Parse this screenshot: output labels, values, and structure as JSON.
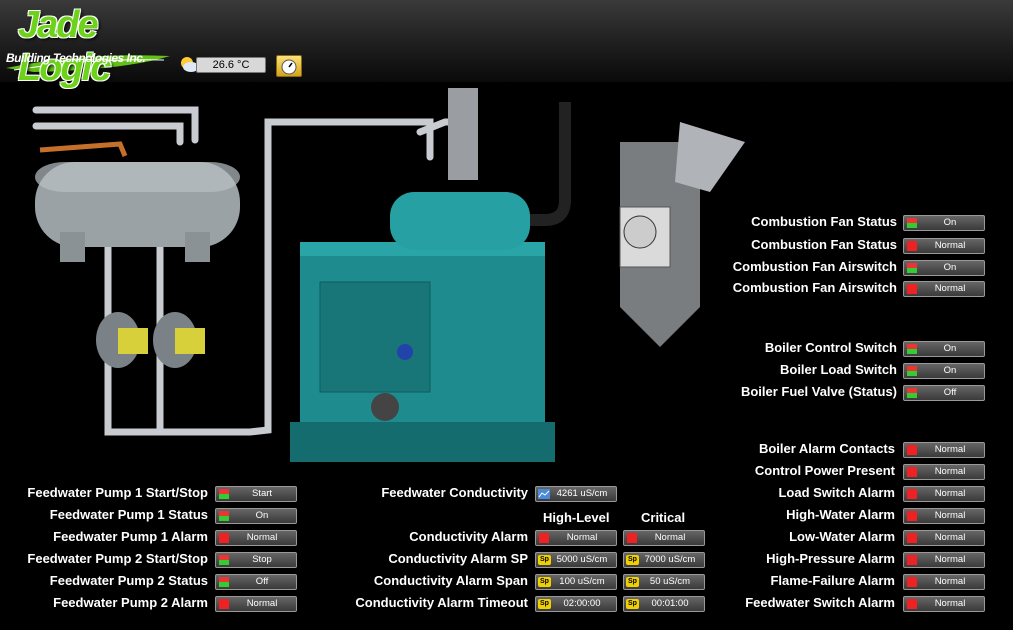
{
  "brand": {
    "name_part1": "Jade",
    "name_part2": "Logic",
    "subtitle": "Building Technologies Inc.",
    "green": "#6cd31a"
  },
  "weather": {
    "temperature": "26.6 °C",
    "icon": "partly-cloudy-icon"
  },
  "colors": {
    "led_green": "#33cc33",
    "led_red": "#ee2222",
    "sp_yellow": "#f0d000",
    "boiler_teal": "#1e8c8e"
  },
  "combustion": [
    {
      "label": "Combustion Fan Status",
      "value": "On",
      "led": "green"
    },
    {
      "label": "Combustion Fan Status",
      "value": "Normal",
      "led": "red"
    },
    {
      "label": "Combustion Fan Airswitch",
      "value": "On",
      "led": "green"
    },
    {
      "label": "Combustion Fan Airswitch",
      "value": "Normal",
      "led": "red"
    }
  ],
  "boiler_switches": [
    {
      "label": "Boiler Control Switch",
      "value": "On",
      "led": "green"
    },
    {
      "label": "Boiler Load Switch",
      "value": "On",
      "led": "green"
    },
    {
      "label": "Boiler Fuel Valve (Status)",
      "value": "Off",
      "led": "green"
    }
  ],
  "alarms": [
    {
      "label": "Boiler Alarm Contacts",
      "value": "Normal"
    },
    {
      "label": "Control Power Present",
      "value": "Normal"
    },
    {
      "label": "Load Switch Alarm",
      "value": "Normal"
    },
    {
      "label": "High-Water Alarm",
      "value": "Normal"
    },
    {
      "label": "Low-Water Alarm",
      "value": "Normal"
    },
    {
      "label": "High-Pressure Alarm",
      "value": "Normal"
    },
    {
      "label": "Flame-Failure Alarm",
      "value": "Normal"
    },
    {
      "label": "Feedwater Switch Alarm",
      "value": "Normal"
    }
  ],
  "pumps": [
    {
      "label": "Feedwater Pump 1 Start/Stop",
      "value": "Start",
      "led": "green"
    },
    {
      "label": "Feedwater Pump 1 Status",
      "value": "On",
      "led": "green"
    },
    {
      "label": "Feedwater Pump 1 Alarm",
      "value": "Normal",
      "led": "red"
    },
    {
      "label": "Feedwater Pump 2 Start/Stop",
      "value": "Stop",
      "led": "green"
    },
    {
      "label": "Feedwater Pump 2 Status",
      "value": "Off",
      "led": "green"
    },
    {
      "label": "Feedwater Pump 2 Alarm",
      "value": "Normal",
      "led": "red"
    }
  ],
  "conductivity": {
    "label": "Feedwater Conductivity",
    "value": "4261 uS/cm",
    "col_high": "High-Level",
    "col_critical": "Critical",
    "rows": [
      {
        "label": "Conductivity Alarm",
        "high": "Normal",
        "critical": "Normal",
        "kind": "led"
      },
      {
        "label": "Conductivity Alarm SP",
        "high": "5000 uS/cm",
        "critical": "7000 uS/cm",
        "kind": "sp"
      },
      {
        "label": "Conductivity Alarm Span",
        "high": "100 uS/cm",
        "critical": "50 uS/cm",
        "kind": "sp"
      },
      {
        "label": "Conductivity Alarm Timeout",
        "high": "02:00:00",
        "critical": "00:01:00",
        "kind": "sp"
      }
    ],
    "sp_tag": "Sp"
  }
}
